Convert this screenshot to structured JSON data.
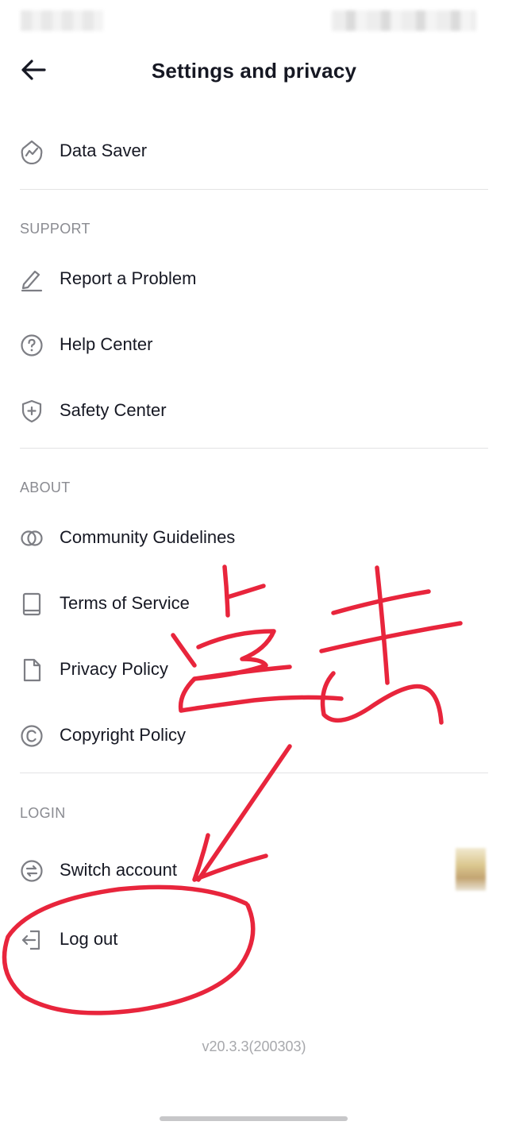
{
  "header": {
    "title": "Settings and privacy",
    "back_icon": "arrow-left-icon"
  },
  "general": [
    {
      "label": "Data Saver",
      "icon": "data-saver-icon"
    }
  ],
  "sections": {
    "support": {
      "title": "SUPPORT",
      "items": [
        {
          "label": "Report a Problem",
          "icon": "pencil-icon"
        },
        {
          "label": "Help Center",
          "icon": "question-circle-icon"
        },
        {
          "label": "Safety Center",
          "icon": "shield-plus-icon"
        }
      ]
    },
    "about": {
      "title": "ABOUT",
      "items": [
        {
          "label": "Community Guidelines",
          "icon": "overlapping-circles-icon"
        },
        {
          "label": "Terms of Service",
          "icon": "book-icon"
        },
        {
          "label": "Privacy Policy",
          "icon": "document-icon"
        },
        {
          "label": "Copyright Policy",
          "icon": "copyright-icon"
        }
      ]
    },
    "login": {
      "title": "LOGIN",
      "items": [
        {
          "label": "Switch account",
          "icon": "switch-arrows-icon"
        },
        {
          "label": "Log out",
          "icon": "logout-icon"
        }
      ]
    }
  },
  "version": "v20.3.3(200303)",
  "colors": {
    "text": "#161823",
    "section": "#8a8b91",
    "divider": "#e3e3e4",
    "annotation": "#e8253c"
  }
}
